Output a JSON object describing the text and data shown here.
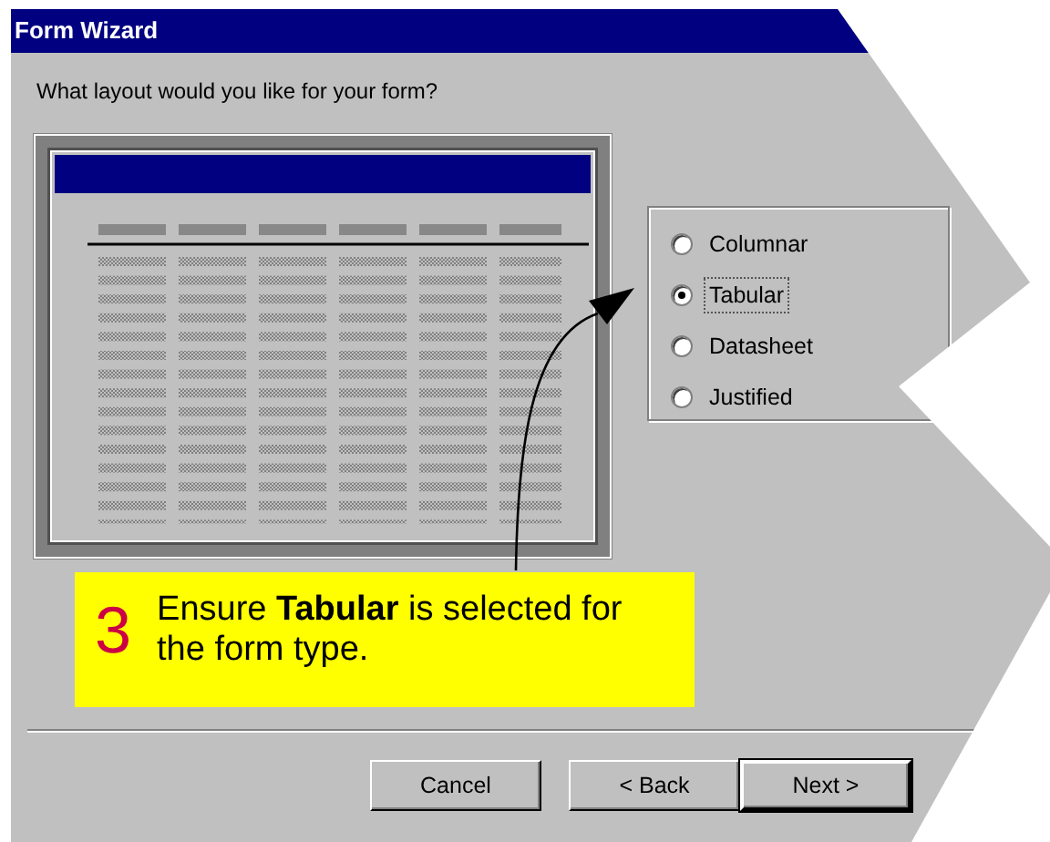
{
  "window": {
    "title": "Form Wizard"
  },
  "prompt": "What layout would you like for your form?",
  "layouts": [
    {
      "label": "Columnar",
      "selected": false
    },
    {
      "label": "Tabular",
      "selected": true
    },
    {
      "label": "Datasheet",
      "selected": false
    },
    {
      "label": "Justified",
      "selected": false
    }
  ],
  "callout": {
    "number": "3",
    "text": "Ensure **Tabular** is selected for the form type."
  },
  "buttons": [
    {
      "label": "Cancel",
      "default": false
    },
    {
      "label": "< Back",
      "default": false
    },
    {
      "label": "Next >",
      "default": true
    }
  ]
}
